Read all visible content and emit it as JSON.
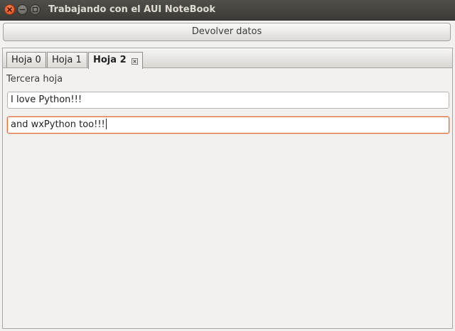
{
  "window": {
    "title": "Trabajando con el AUI NoteBook"
  },
  "toolbar": {
    "devolver_label": "Devolver datos"
  },
  "tabs": [
    {
      "label": "Hoja 0",
      "active": false
    },
    {
      "label": "Hoja 1",
      "active": false
    },
    {
      "label": "Hoja 2",
      "active": true
    }
  ],
  "page": {
    "label": "Tercera hoja",
    "inputs": [
      {
        "value": "I love Python!!!",
        "focused": false
      },
      {
        "value": "and wxPython too!!!",
        "focused": true
      }
    ]
  },
  "colors": {
    "titlebar": "#3c3b37",
    "close_button": "#df4a16",
    "focus_border": "#e2713f",
    "window_bg": "#f2f1f0"
  }
}
